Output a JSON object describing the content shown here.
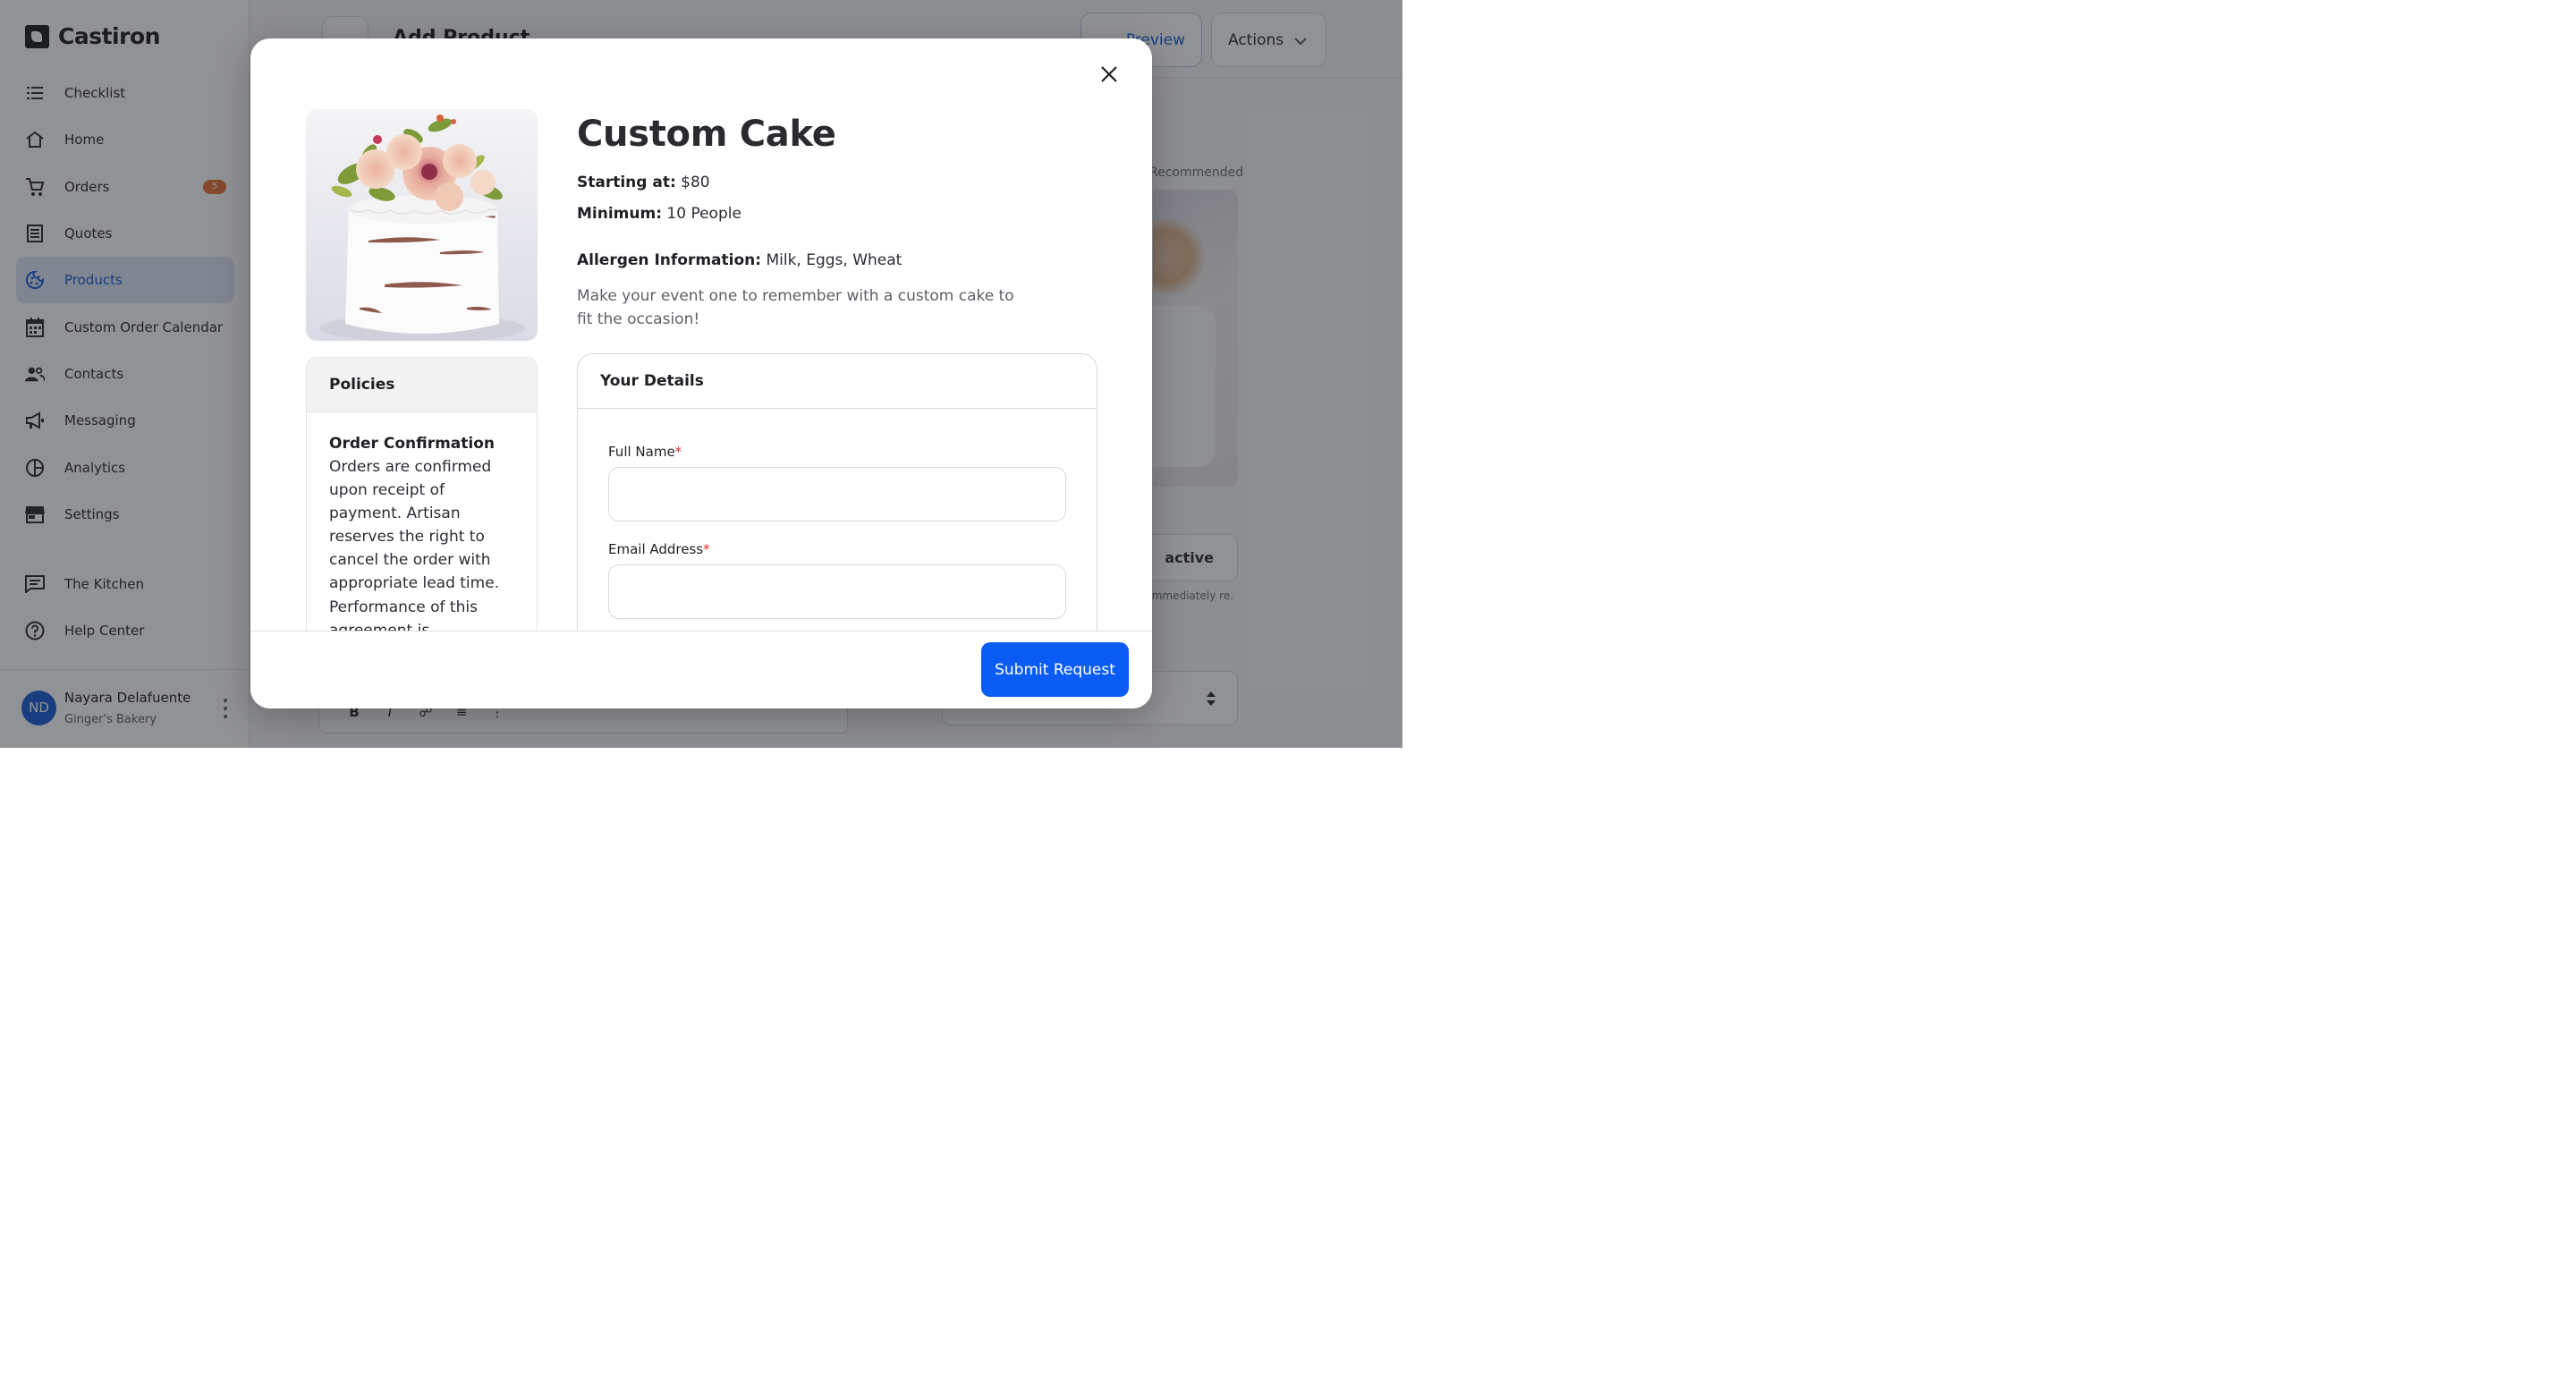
{
  "app": {
    "brand": "Castiron",
    "page_title": "Add Product",
    "header_buttons": {
      "preview": "Preview",
      "actions": "Actions"
    }
  },
  "sidebar": {
    "items": [
      {
        "label": "Checklist",
        "icon": "checklist-icon"
      },
      {
        "label": "Home",
        "icon": "home-icon"
      },
      {
        "label": "Orders",
        "icon": "cart-icon",
        "badge": "5"
      },
      {
        "label": "Quotes",
        "icon": "receipt-icon"
      },
      {
        "label": "Products",
        "icon": "cookie-icon",
        "active": true
      },
      {
        "label": "Custom Order Calendar",
        "icon": "calendar-icon"
      },
      {
        "label": "Contacts",
        "icon": "people-icon"
      },
      {
        "label": "Messaging",
        "icon": "megaphone-icon"
      },
      {
        "label": "Analytics",
        "icon": "pie-chart-icon"
      },
      {
        "label": "Settings",
        "icon": "storefront-icon"
      }
    ],
    "secondary": [
      {
        "label": "The Kitchen",
        "icon": "chat-icon"
      },
      {
        "label": "Help Center",
        "icon": "help-icon"
      }
    ],
    "user": {
      "initials": "ND",
      "name": "Nayara Delafuente",
      "org": "Ginger's Bakery"
    }
  },
  "background": {
    "recommended": "Recommended",
    "status_label": "active",
    "status_note": "mmediately re.",
    "editor_tools": [
      "B",
      "I",
      "link",
      "ol",
      "ul"
    ]
  },
  "modal": {
    "title": "Custom Cake",
    "starting_label": "Starting at:",
    "starting_value": "$80",
    "minimum_label": "Minimum:",
    "minimum_value": "10 People",
    "allergen_label": "Allergen Information:",
    "allergen_value": "Milk, Eggs, Wheat",
    "description": "Make your event one to remember with a custom cake to fit the occasion!",
    "policies": {
      "heading": "Policies",
      "title": "Order Confirmation",
      "text": "Orders are confirmed upon receipt of payment. Artisan reserves the right to cancel the order with appropriate lead time. Performance of this agreement is contingent upon our ability to"
    },
    "details": {
      "heading": "Your Details",
      "full_name_label": "Full Name",
      "full_name_value": "",
      "email_label": "Email Address",
      "email_value": "",
      "required_mark": "*"
    },
    "submit_label": "Submit Request"
  },
  "colors": {
    "accent": "#0b5cf5",
    "badge": "#e8743b",
    "required": "#d62c2c"
  }
}
